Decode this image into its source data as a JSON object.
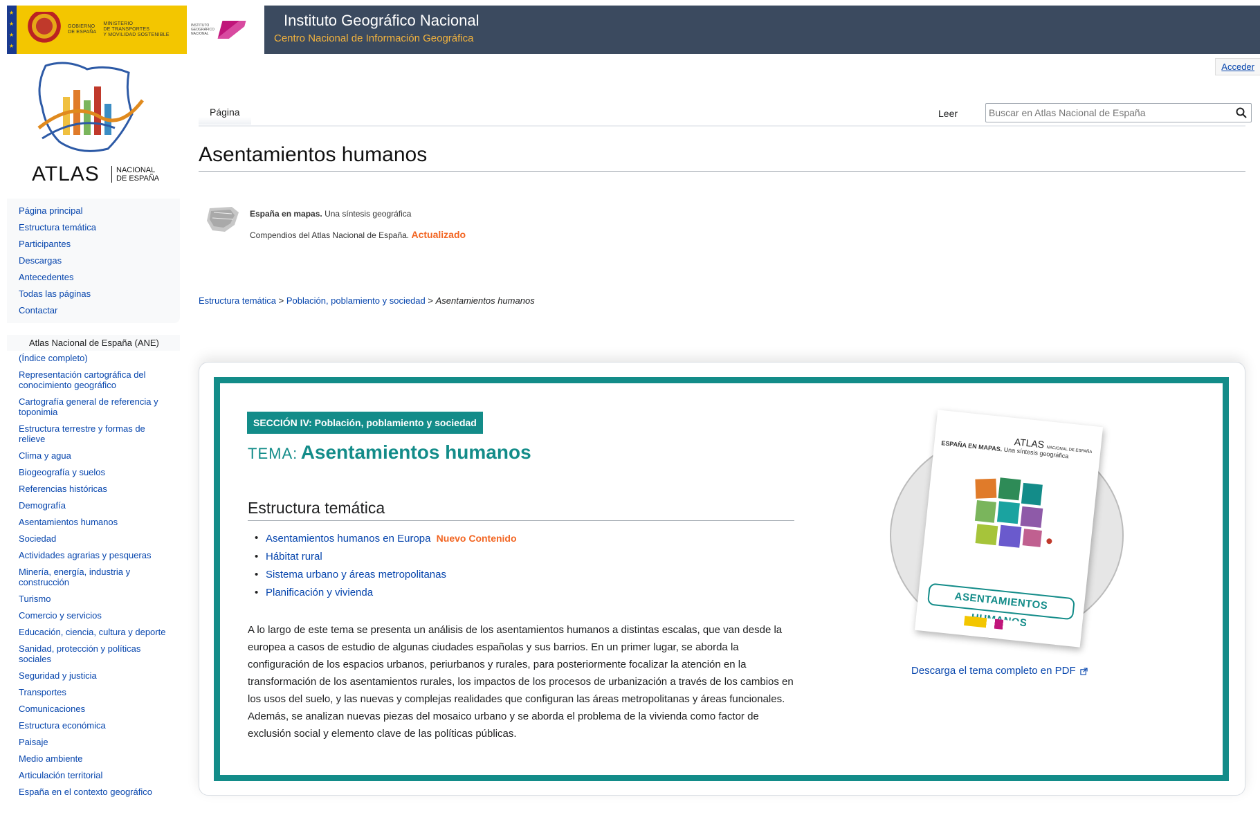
{
  "header": {
    "gov_text": [
      "GOBIERNO",
      "DE ESPAÑA"
    ],
    "ministry_text": [
      "MINISTERIO",
      "DE TRANSPORTES",
      "Y MOVILIDAD SOSTENIBLE"
    ],
    "ign_text": [
      "INSTITUTO",
      "GEOGRÁFICO",
      "NACIONAL"
    ],
    "institute_title": "Instituto Geográfico Nacional",
    "institute_subtitle": "Centro Nacional de Información Geográfica",
    "login_link": "Acceder",
    "colors": {
      "banner": "#3b4a5f",
      "gov_yellow": "#f3c600",
      "subtitle_orange": "#f3b33d"
    }
  },
  "logo": {
    "atlas": "ATLAS",
    "nacional": [
      "NACIONAL",
      "DE ESPAÑA"
    ]
  },
  "sidebar": {
    "main_links": [
      "Página principal",
      "Estructura temática",
      "Participantes",
      "Descargas",
      "Antecedentes",
      "Todas las páginas",
      "Contactar"
    ],
    "ane_heading": "Atlas Nacional de España (ANE)",
    "ane_links": [
      "(Índice completo)",
      "Representación cartográfica del conocimiento geográfico",
      "Cartografía general de referencia y toponimia",
      "Estructura terrestre y formas de relieve",
      "Clima y agua",
      "Biogeografía y suelos",
      "Referencias históricas",
      "Demografía",
      "Asentamientos humanos",
      "Sociedad",
      "Actividades agrarias y pesqueras",
      "Minería, energía, industria y construcción",
      "Turismo",
      "Comercio y servicios",
      "Educación, ciencia, cultura y deporte",
      "Sanidad, protección y políticas sociales",
      "Seguridad y justicia",
      "Transportes",
      "Comunicaciones",
      "Estructura económica",
      "Paisaje",
      "Medio ambiente",
      "Articulación territorial",
      "España en el contexto geográfico"
    ]
  },
  "tabs": {
    "page": "Página",
    "read": "Leer"
  },
  "search": {
    "placeholder": "Buscar en Atlas Nacional de España",
    "icon": "search-icon"
  },
  "page": {
    "title": "Asentamientos humanos",
    "compendium_title": "España en mapas.",
    "compendium_subtitle": "Una síntesis geográfica",
    "compendium_line2": "Compendios del Atlas Nacional de España.",
    "compendium_updated": "Actualizado",
    "breadcrumb": {
      "level1": "Estructura temática",
      "sep": ">",
      "level2": "Población, poblamiento y sociedad",
      "current": "Asentamientos humanos"
    }
  },
  "card": {
    "section_badge": "SECCIÓN IV: Población, poblamiento y sociedad",
    "tema_prefix": "TEMA:",
    "tema_title": "Asentamientos humanos",
    "structure_heading": "Estructura temática",
    "topics": [
      {
        "label": "Asentamientos humanos en Europa",
        "badge": "Nuevo Contenido"
      },
      {
        "label": "Hábitat rural",
        "badge": ""
      },
      {
        "label": "Sistema urbano y áreas metropolitanas",
        "badge": ""
      },
      {
        "label": "Planificación y vivienda",
        "badge": ""
      }
    ],
    "description": "A lo largo de este tema se presenta un análisis de los asentamientos humanos a distintas escalas, que van desde la europea a casos de estudio de algunas ciudades españolas y sus barrios. En un primer lugar, se aborda la configuración de los espacios urbanos, periurbanos y rurales, para posteriormente focalizar la atención en la transformación de los asentamientos rurales, los impactos de los procesos de urbanización a través de los cambios en los usos del suelo, y las nuevas y complejas realidades que configuran las áreas metropolitanas y áreas funcionales. Además, se analizan nuevas piezas del mosaico urbano y se aborda el problema de la vivienda como factor de exclusión social y elemento clave de las políticas públicas.",
    "cover": {
      "atlas": "ATLAS",
      "atlas_small": "NACIONAL DE ESPAÑA",
      "spain_maps": "ESPAÑA EN MAPAS.",
      "spain_maps_sub": "Una síntesis geográfica",
      "band": "ASENTAMIENTOS HUMANOS"
    },
    "pdf_link": "Descarga el tema completo en PDF",
    "colors": {
      "teal": "#138c89",
      "orange": "#f26522",
      "link": "#0645ad"
    }
  }
}
